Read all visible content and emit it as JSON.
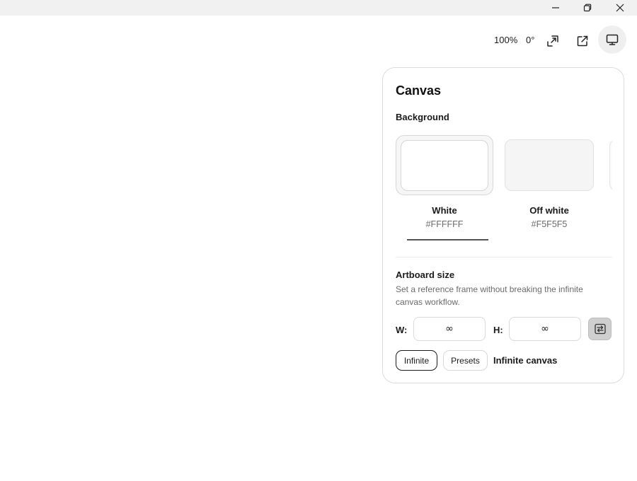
{
  "window_controls": {
    "minimize_icon": "minimize-icon",
    "maximize_icon": "restore-icon",
    "close_icon": "close-icon"
  },
  "toolbar": {
    "zoom": "100%",
    "rotation": "0°",
    "icons": [
      "fit-to-screen-icon",
      "open-external-icon",
      "monitor-icon"
    ]
  },
  "panel": {
    "title": "Canvas",
    "background": {
      "label": "Background",
      "selected_index": 0,
      "swatches": [
        {
          "name": "White",
          "hex": "#FFFFFF",
          "color": "#FFFFFF"
        },
        {
          "name": "Off white",
          "hex": "#F5F5F5",
          "color": "#F5F5F5"
        }
      ]
    },
    "artboard": {
      "label": "Artboard size",
      "description": "Set a reference frame without breaking the infinite canvas workflow.",
      "width_label": "W:",
      "height_label": "H:",
      "width_value": "∞",
      "height_value": "∞",
      "link_icon": "swap-dimensions-icon",
      "modes": [
        {
          "label": "Infinite",
          "selected": true
        },
        {
          "label": "Presets",
          "selected": false
        }
      ],
      "mode_label": "Infinite canvas"
    }
  },
  "colors": {
    "titlebar": "#F1F1F1",
    "panel_border": "#DCDCDC",
    "active_tool_bg": "#EFEFEF",
    "link_button_bg": "#CFCFCF"
  }
}
